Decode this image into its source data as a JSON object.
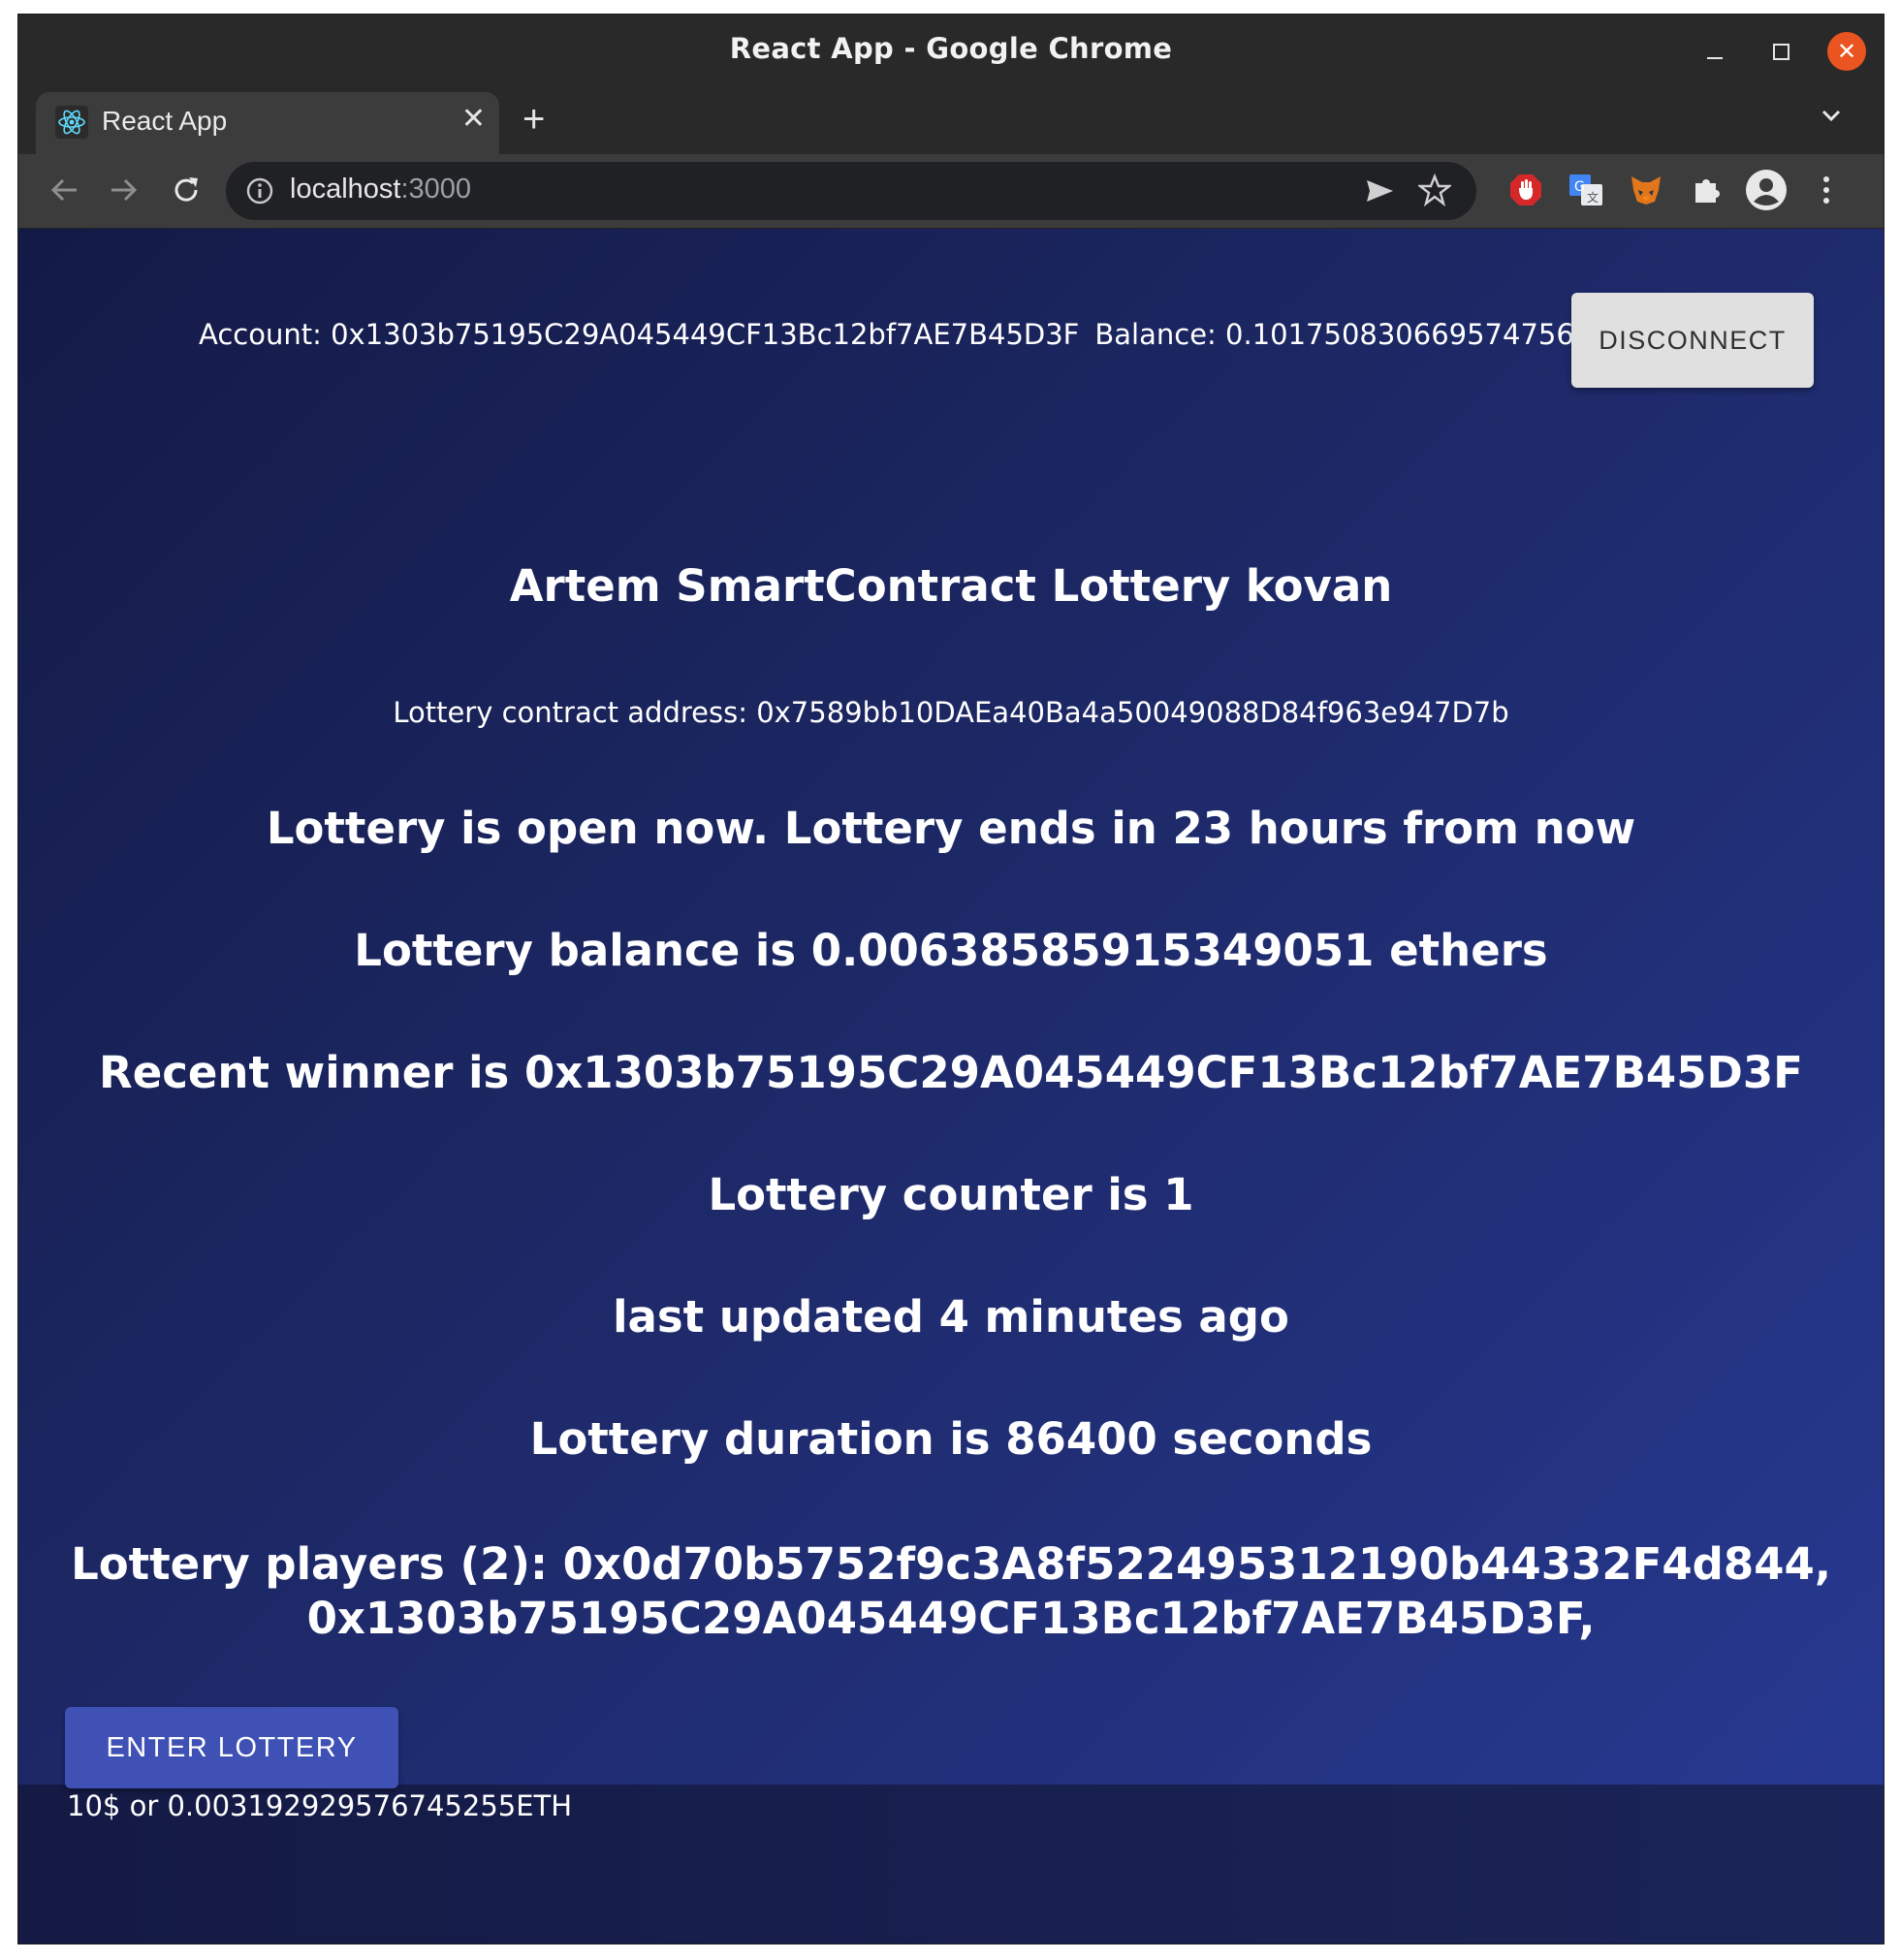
{
  "window": {
    "title": "React App - Google Chrome"
  },
  "tabs": [
    {
      "label": "React App",
      "icon": "react-logo-icon"
    }
  ],
  "toolbar": {
    "url_host": "localhost",
    "url_port": ":3000"
  },
  "colors": {
    "page_bg_start": "#141a46",
    "page_bg_end": "#283a94",
    "enter_button": "#3f51b5",
    "disconnect_button": "#e0e0e0",
    "close_button": "#e95420"
  },
  "header": {
    "account": "Account: 0x1303b75195C29A045449CF13Bc12bf7AE7B45D3F",
    "balance": "Balance: 0.101750830669574756",
    "disconnect_label": "DISCONNECT"
  },
  "main": {
    "title": "Artem SmartContract Lottery kovan",
    "contract_address": "Lottery contract address: 0x7589bb10DAEa40Ba4a50049088D84f963e947D7b",
    "status": "Lottery is open now. Lottery ends in 23 hours from now",
    "balance": "Lottery balance is 0.006385859153490 51 ethers",
    "recent_winner": "Recent winner is 0x1303b75195C29A045449CF13Bc12bf7AE7B45D3F",
    "counter": "Lottery counter is 1",
    "last_updated": "last updated 4 minutes ago",
    "duration": "Lottery duration is 86400 seconds",
    "players_line1": "Lottery players (2): 0x0d70b5752f9c3A8f522495312190b44332F4d844,",
    "players_line2": "0x1303b75195C29A045449CF13Bc12bf7AE7B45D3F,",
    "enter_label": "ENTER LOTTERY",
    "price": "10$ or 0.003192929576745255ETH"
  }
}
